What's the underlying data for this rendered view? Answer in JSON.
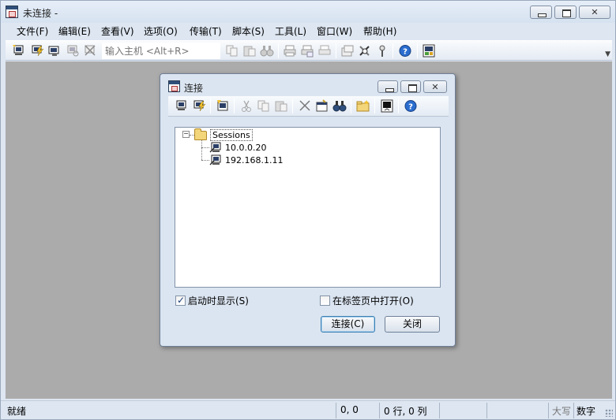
{
  "window": {
    "title": "未连接 -"
  },
  "menu": [
    "文件(F)",
    "编辑(E)",
    "查看(V)",
    "选项(O)",
    "传输(T)",
    "脚本(S)",
    "工具(L)",
    "窗口(W)",
    "帮助(H)"
  ],
  "toolbar": {
    "host_placeholder": "输入主机 <Alt+R>"
  },
  "dialog": {
    "title": "连接",
    "tree": {
      "root": "Sessions",
      "items": [
        "10.0.0.20",
        "192.168.1.11"
      ]
    },
    "show_on_startup": {
      "label": "启动时显示(S)",
      "checked": true
    },
    "open_in_tab": {
      "label": "在标签页中打开(O)",
      "checked": false
    },
    "connect_label": "连接(C)",
    "close_label": "关闭"
  },
  "status": {
    "ready": "就绪",
    "position": "0, 0",
    "row_col": "0 行, 0 列",
    "caps": "大写",
    "num": "数字"
  },
  "icons": {
    "toolbar": [
      "connect-icon",
      "quick-connect-icon",
      "connect-in-tab-icon",
      "reconnect-icon",
      "disconnect-icon",
      "copy-icon",
      "paste-icon",
      "find-icon",
      "print-icon",
      "print-setup-icon",
      "print-selection-icon",
      "session-options-icon",
      "global-options-icon",
      "keymap-icon",
      "help-icon",
      "sftp-icon"
    ],
    "dialog_toolbar": [
      "connect-icon",
      "quick-connect-icon",
      "new-session-icon",
      "cut-icon",
      "copy-icon",
      "paste-icon",
      "delete-icon",
      "properties-icon",
      "find-icon",
      "new-folder-icon",
      "create-shortcut-icon",
      "help-icon"
    ]
  }
}
